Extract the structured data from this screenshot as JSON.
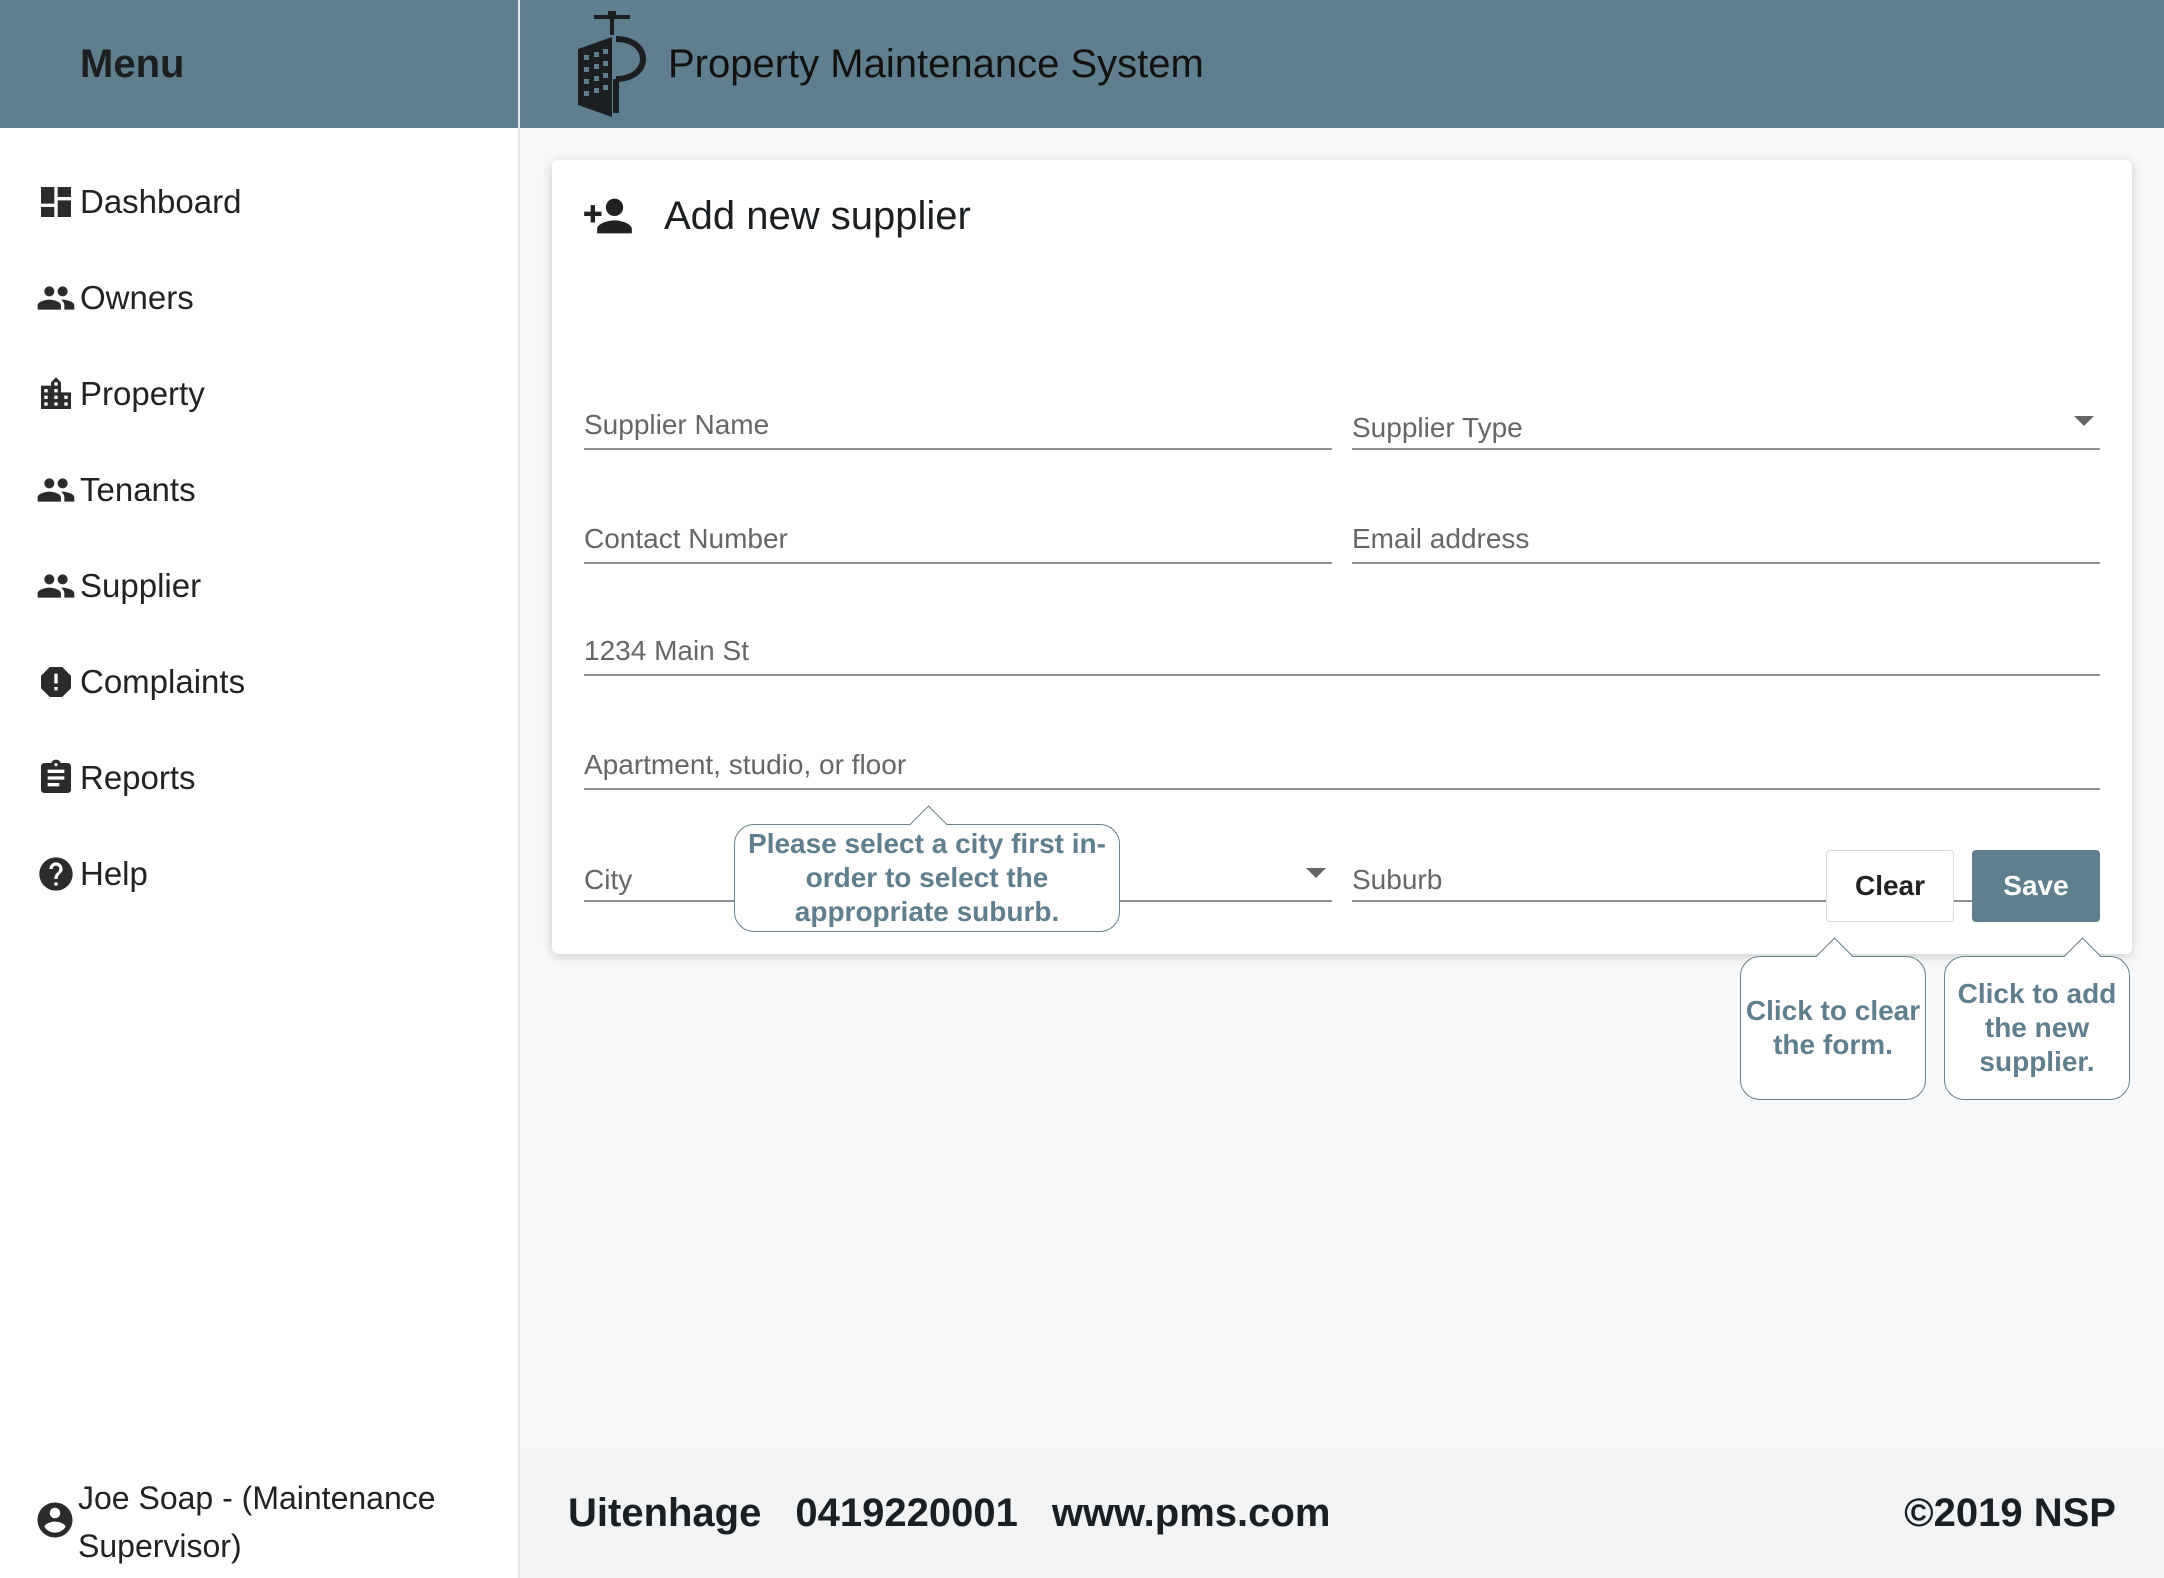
{
  "sidebar": {
    "title": "Menu",
    "items": [
      {
        "label": "Dashboard",
        "icon": "dashboard-icon"
      },
      {
        "label": "Owners",
        "icon": "people-icon"
      },
      {
        "label": "Property",
        "icon": "building-icon"
      },
      {
        "label": "Tenants",
        "icon": "people-icon"
      },
      {
        "label": "Supplier",
        "icon": "people-icon"
      },
      {
        "label": "Complaints",
        "icon": "alert-icon"
      },
      {
        "label": "Reports",
        "icon": "clipboard-icon"
      },
      {
        "label": "Help",
        "icon": "help-icon"
      }
    ],
    "user": "Joe Soap - (Maintenance Supervisor)"
  },
  "header": {
    "title": "Property Maintenance System"
  },
  "form": {
    "title": "Add new supplier",
    "supplier_name": {
      "placeholder": "Supplier Name",
      "value": ""
    },
    "supplier_type": {
      "placeholder": "Supplier Type",
      "value": ""
    },
    "contact_number": {
      "placeholder": "Contact Number",
      "value": ""
    },
    "email": {
      "placeholder": "Email address",
      "value": ""
    },
    "address1": {
      "placeholder": "1234 Main St",
      "value": ""
    },
    "address2": {
      "placeholder": "Apartment, studio, or floor",
      "value": ""
    },
    "city": {
      "placeholder": "City",
      "value": ""
    },
    "suburb": {
      "placeholder": "Suburb",
      "value": ""
    },
    "clear_label": "Clear",
    "save_label": "Save"
  },
  "tooltips": {
    "city": "Please select a city first in-order to select the appropriate suburb.",
    "clear": "Click to clear the form.",
    "save": "Click to add the new supplier."
  },
  "footer": {
    "city": "Uitenhage",
    "phone": "0419220001",
    "website": "www.pms.com",
    "copyright": "©2019 NSP"
  },
  "colors": {
    "accent": "#5f7f8e",
    "background": "#f7f8f9"
  }
}
